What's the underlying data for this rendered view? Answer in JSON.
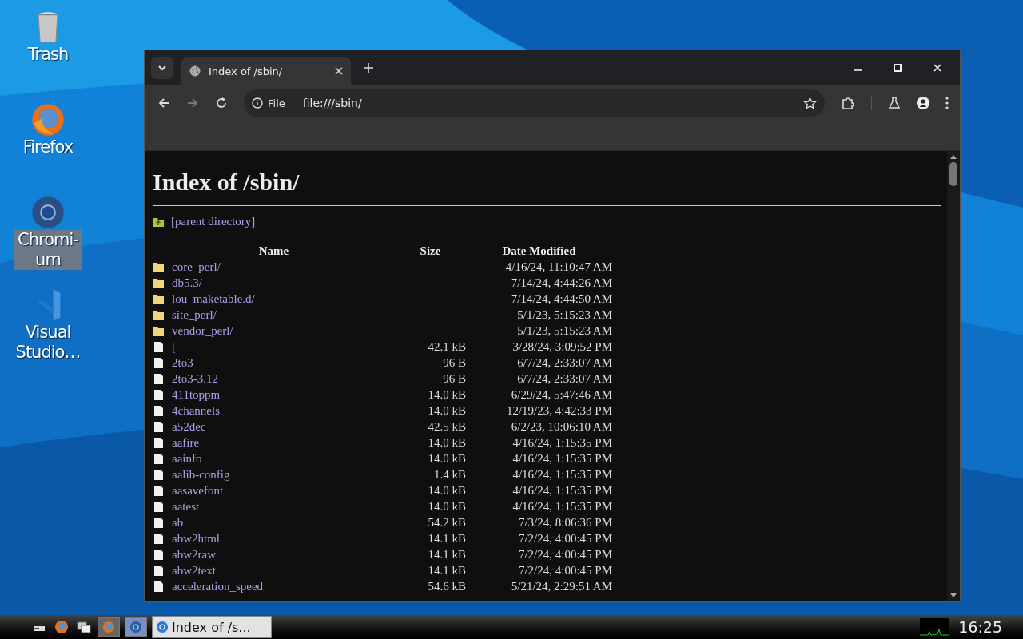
{
  "desktop_icons": [
    {
      "label": "Trash",
      "kind": "trash",
      "selected": false
    },
    {
      "label": "Firefox",
      "kind": "firefox",
      "selected": false
    },
    {
      "label": "Chromi-\num",
      "kind": "chromium",
      "selected": true
    },
    {
      "label": "Visual\nStudio…",
      "kind": "vscode",
      "selected": false
    }
  ],
  "browser": {
    "tab_title": "Index of /sbin/",
    "address_chip": "File",
    "url": "file:///sbin/"
  },
  "page": {
    "heading": "Index of /sbin/",
    "parent_link": "[parent directory]",
    "columns": [
      "Name",
      "Size",
      "Date Modified"
    ],
    "rows": [
      {
        "kind": "folder",
        "name": "core_perl/",
        "size": "",
        "date": "4/16/24, 11:10:47 AM"
      },
      {
        "kind": "folder",
        "name": "db5.3/",
        "size": "",
        "date": "7/14/24, 4:44:26 AM"
      },
      {
        "kind": "folder",
        "name": "lou_maketable.d/",
        "size": "",
        "date": "7/14/24, 4:44:50 AM"
      },
      {
        "kind": "folder",
        "name": "site_perl/",
        "size": "",
        "date": "5/1/23, 5:15:23 AM"
      },
      {
        "kind": "folder",
        "name": "vendor_perl/",
        "size": "",
        "date": "5/1/23, 5:15:23 AM"
      },
      {
        "kind": "file",
        "name": "[",
        "size": "42.1 kB",
        "date": "3/28/24, 3:09:52 PM"
      },
      {
        "kind": "file",
        "name": "2to3",
        "size": "96 B",
        "date": "6/7/24, 2:33:07 AM"
      },
      {
        "kind": "file",
        "name": "2to3-3.12",
        "size": "96 B",
        "date": "6/7/24, 2:33:07 AM"
      },
      {
        "kind": "file",
        "name": "411toppm",
        "size": "14.0 kB",
        "date": "6/29/24, 5:47:46 AM"
      },
      {
        "kind": "file",
        "name": "4channels",
        "size": "14.0 kB",
        "date": "12/19/23, 4:42:33 PM"
      },
      {
        "kind": "file",
        "name": "a52dec",
        "size": "42.5 kB",
        "date": "6/2/23, 10:06:10 AM"
      },
      {
        "kind": "file",
        "name": "aafire",
        "size": "14.0 kB",
        "date": "4/16/24, 1:15:35 PM"
      },
      {
        "kind": "file",
        "name": "aainfo",
        "size": "14.0 kB",
        "date": "4/16/24, 1:15:35 PM"
      },
      {
        "kind": "file",
        "name": "aalib-config",
        "size": "1.4 kB",
        "date": "4/16/24, 1:15:35 PM"
      },
      {
        "kind": "file",
        "name": "aasavefont",
        "size": "14.0 kB",
        "date": "4/16/24, 1:15:35 PM"
      },
      {
        "kind": "file",
        "name": "aatest",
        "size": "14.0 kB",
        "date": "4/16/24, 1:15:35 PM"
      },
      {
        "kind": "file",
        "name": "ab",
        "size": "54.2 kB",
        "date": "7/3/24, 8:06:36 PM"
      },
      {
        "kind": "file",
        "name": "abw2html",
        "size": "14.1 kB",
        "date": "7/2/24, 4:00:45 PM"
      },
      {
        "kind": "file",
        "name": "abw2raw",
        "size": "14.1 kB",
        "date": "7/2/24, 4:00:45 PM"
      },
      {
        "kind": "file",
        "name": "abw2text",
        "size": "14.1 kB",
        "date": "7/2/24, 4:00:45 PM"
      },
      {
        "kind": "file",
        "name": "acceleration_speed",
        "size": "54.6 kB",
        "date": "5/21/24, 2:29:51 AM"
      }
    ]
  },
  "taskbar": {
    "launchers": [
      {
        "kind": "files"
      },
      {
        "kind": "firefox"
      },
      {
        "kind": "window"
      }
    ],
    "buttons": [
      {
        "kind": "firefox",
        "selected": false
      },
      {
        "kind": "chromium",
        "selected": true
      }
    ],
    "task": {
      "label": "Index of /s...",
      "selected": true
    },
    "clock": "16:25"
  }
}
